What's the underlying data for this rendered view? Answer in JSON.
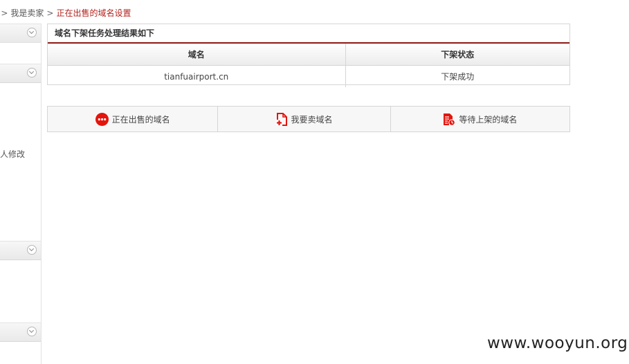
{
  "breadcrumb": {
    "items": [
      "ʹ",
      "我是卖家",
      "正在出售的域名设置"
    ],
    "separator": ">"
  },
  "sidebar": {
    "partial_text": "人修改"
  },
  "panel": {
    "title": "域名下架任务处理结果如下",
    "columns": [
      "域名",
      "下架状态"
    ],
    "rows": [
      {
        "domain": "tianfuairport.cn",
        "status": "下架成功"
      }
    ],
    "accent_color": "#8b1a14"
  },
  "actions": [
    {
      "label": "正在出售的域名",
      "icon": "more-dots-icon"
    },
    {
      "label": "我要卖域名",
      "icon": "sell-document-icon"
    },
    {
      "label": "等待上架的域名",
      "icon": "pending-list-icon"
    }
  ],
  "watermark": "www.wooyun.org",
  "colors": {
    "brand_red": "#e3150d",
    "breadcrumb_current": "#b3211c"
  }
}
